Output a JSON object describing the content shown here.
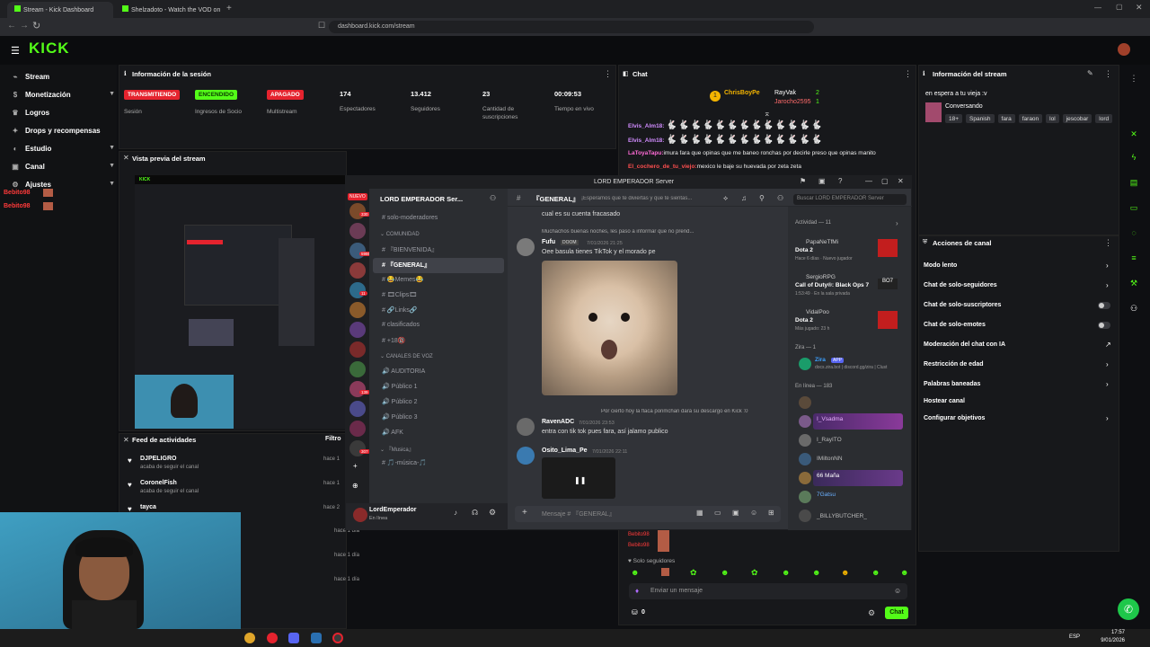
{
  "browser": {
    "tabs": [
      {
        "label": "Stream - Kick Dashboard"
      },
      {
        "label": "Shelzadoto - Watch the VOD on"
      }
    ],
    "url": "dashboard.kick.com/stream"
  },
  "brand": {
    "logo": "KICK",
    "accent": "#53fc18"
  },
  "sidebar": {
    "items": [
      {
        "label": "Stream",
        "icon": "broadcast-icon"
      },
      {
        "label": "Monetización",
        "icon": "dollar-icon"
      },
      {
        "label": "Logros",
        "icon": "trophy-icon"
      },
      {
        "label": "Drops y recompensas",
        "icon": "gift-icon"
      },
      {
        "label": "Estudio",
        "icon": "palette-icon"
      },
      {
        "label": "Canal",
        "icon": "tv-icon"
      },
      {
        "label": "Ajustes",
        "icon": "gear-icon"
      }
    ],
    "overlay_names": [
      "Bebito98",
      "Bebito98"
    ]
  },
  "session": {
    "title": "Información de la sesión",
    "status": [
      {
        "badge": "TRANSMITIENDO",
        "label": "Sesión",
        "color": "#e5232e"
      },
      {
        "badge": "ENCENDIDO",
        "label": "Ingresos de Socio",
        "color": "#53fc18"
      },
      {
        "badge": "APAGADO",
        "label": "Multistream",
        "color": "#e5232e"
      }
    ],
    "stats": [
      {
        "value": "174",
        "label": "Espectadores"
      },
      {
        "value": "13.412",
        "label": "Seguidores"
      },
      {
        "value": "23",
        "label": "Cantidad de suscripciones"
      },
      {
        "value": "00:09:53",
        "label": "Tiempo en vivo"
      }
    ]
  },
  "preview": {
    "title": "Vista previa del stream"
  },
  "feed": {
    "title": "Feed de actividades",
    "filter": "Filtro",
    "items": [
      {
        "name": "DJPELIGRO",
        "action": "acaba de seguir el canal",
        "time": "hace 1"
      },
      {
        "name": "CoronelFish",
        "action": "acaba de seguir el canal",
        "time": "hace 1"
      },
      {
        "name": "tayca",
        "action": "",
        "time": "hace 2"
      }
    ],
    "times": [
      "hace 1 día",
      "hace 1 día",
      "hace 1 día"
    ]
  },
  "chat": {
    "title": "Chat",
    "top": [
      {
        "name": "ChrisBoyPe",
        "count": ""
      },
      {
        "name": "RayVak",
        "count": "2"
      },
      {
        "name": "Jarocho2595",
        "count": "1"
      }
    ],
    "messages": [
      {
        "user": "Elvis_Alm18:",
        "text": "🐇🐇🐇🐇🐇🐇🐇🐇🐇🐇🐇🐇🐇",
        "color": "#d18cff"
      },
      {
        "user": "Elvis_Alm18:",
        "text": "🐇🐇🐇🐇🐇🐇🐇🐇🐇🐇🐇🐇🐇",
        "color": "#d18cff"
      },
      {
        "user": "LaToyaTapu:",
        "text": "imura fara que opinas que me baneo ronchas por decirle preso que opinas manito",
        "color": "#ff6bd6"
      },
      {
        "user": "El_cochero_de_tu_viejo:",
        "text": "mexico le baje su huevada por zeta zeta",
        "color": "#ff4f4f"
      }
    ],
    "lower_names": [
      "Bebito98",
      "Bebito98"
    ],
    "solo_label": "Solo seguidores",
    "input_placeholder": "Enviar un mensaje",
    "points": "0",
    "send": "Chat"
  },
  "stream_info": {
    "title": "Información del stream",
    "stream_title": "en espera a tu vieja :v",
    "category": "Conversando",
    "tags": [
      "18+",
      "Spanish",
      "fara",
      "faraon",
      "lol",
      "jescobar",
      "lord"
    ]
  },
  "channel_actions": {
    "title": "Acciones de canal",
    "items": [
      {
        "label": "Modo lento",
        "control": "arrow"
      },
      {
        "label": "Chat de solo-seguidores",
        "control": "arrow"
      },
      {
        "label": "Chat de solo-suscriptores",
        "control": "toggle"
      },
      {
        "label": "Chat de solo-emotes",
        "control": "toggle"
      },
      {
        "label": "Moderación del chat con IA",
        "control": "link"
      },
      {
        "label": "Restricción de edad",
        "control": "arrow"
      },
      {
        "label": "Palabras baneadas",
        "control": "arrow"
      },
      {
        "label": "Hostear canal",
        "control": "none"
      },
      {
        "label": "Configurar objetivos",
        "control": "arrow"
      }
    ]
  },
  "discord": {
    "window_title": "LORD EMPERADOR Server",
    "server_name": "LORD EMPERADOR Ser...",
    "new_badge": "NUEVO",
    "server_badges": [
      "330",
      "16",
      "5986",
      "30",
      "11",
      "23",
      "1",
      "139",
      "301",
      "307"
    ],
    "channels": [
      {
        "label": "solo-moderadores",
        "icon": "#"
      },
      {
        "label": "COMUNIDAD",
        "icon": "⌄",
        "category": true
      },
      {
        "label": "『BIENVENIDA』",
        "icon": "#"
      },
      {
        "label": "『GENERAL』",
        "icon": "#",
        "selected": true
      },
      {
        "label": "😂Memes😂",
        "icon": "#"
      },
      {
        "label": "🎞Clips🎞",
        "icon": "#"
      },
      {
        "label": "🔗Links🔗",
        "icon": "#"
      },
      {
        "label": "clasificados",
        "icon": "#"
      },
      {
        "label": "+18🔞",
        "icon": "#"
      },
      {
        "label": "CANALES DE VOZ",
        "icon": "⌄",
        "category": true
      },
      {
        "label": "AUDITORIA",
        "icon": "🔊"
      },
      {
        "label": "Público 1",
        "icon": "🔊"
      },
      {
        "label": "Público 2",
        "icon": "🔊"
      },
      {
        "label": "Público 3",
        "icon": "🔊"
      },
      {
        "label": "AFK",
        "icon": "🔊"
      },
      {
        "label": "『Musica』",
        "icon": "⌄",
        "category": true
      },
      {
        "label": "🎵-música-🎵",
        "icon": "#"
      },
      {
        "label": "Música - 1",
        "icon": "🔊"
      }
    ],
    "user": {
      "name": "LordEmperador",
      "status": "En línea"
    },
    "channel_header": "『GENERAL』",
    "channel_topic": "¡Esperamos que te diviertas y que te sientas...",
    "search_placeholder": "Buscar LORD EMPERADOR Server",
    "messages": [
      {
        "user": "",
        "time": "",
        "text": "cual es su cuenta fracasado",
        "reply": ""
      },
      {
        "user": "Fufu",
        "tag": "DOOM",
        "time": "7/01/2026 21:25",
        "reply": "Muchachos buenas noches, les paso a informar que no prend...",
        "text": "Oee basula tienes TikTok y el morado pe"
      },
      {
        "user": "RavenADC",
        "time": "7/01/2026 23:53",
        "reply": "Por cierto hoy la flaca ponmchan dará su descargo en Kick :0",
        "text": "entra con tik tok pues fara, así jalamo publico"
      },
      {
        "user": "Osito_Lima_Pe",
        "time": "7/01/2026 22:11",
        "reply": "",
        "text": ""
      }
    ],
    "input_placeholder": "Mensaje # 『GENERAL』",
    "activity_title": "Actividad — 11",
    "activity": [
      {
        "user": "PapaNeTfMi",
        "game": "Dota 2",
        "sub": "Hace 6 días · Nuevo jugador"
      },
      {
        "user": "SergioRPG",
        "game": "Call of Duty®: Black Ops 7",
        "sub": "1:53:49 · En la sala privada"
      },
      {
        "user": "VidalPoo",
        "game": "Dota 2",
        "sub": "Más jugado: 23 h"
      }
    ],
    "zira_header": "Zira — 1",
    "zira": {
      "name": "Zira",
      "tag": "APP",
      "sub": "docs.zira.bot | discord.gg/zira | Clust"
    },
    "online_header": "En línea — 183",
    "members": [
      "J",
      "I_Vsadma",
      "I_RayITO",
      "IMiltonNN",
      "66 Maña",
      "7Gatsu",
      "_BILLYBUTCHER_"
    ]
  },
  "taskbar": {
    "lang": "ESP",
    "time": "17:57",
    "date": "9/01/2026"
  }
}
